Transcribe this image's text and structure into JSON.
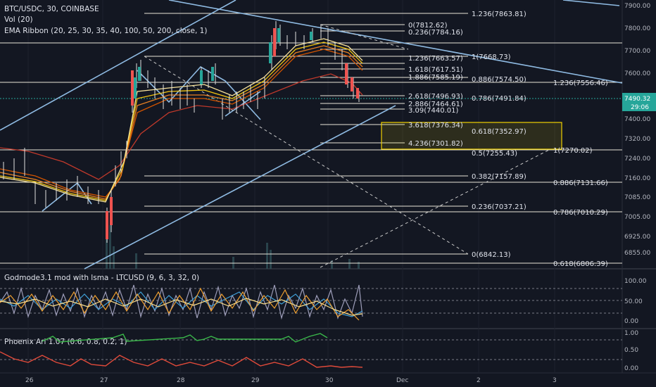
{
  "header": {
    "symbol_line": "BTC/USDC, 30, COINBASE",
    "vol_label": "Vol (20)",
    "ema_label": "EMA Ribbon (20, 25, 30, 35, 40, 100, 50, 200, close, 1)"
  },
  "price_axis": {
    "ticks": [
      "7900.00",
      "7800.00",
      "7700.00",
      "7600.00",
      "7490.32",
      "29:06",
      "7400.00",
      "7320.00",
      "7240.00",
      "7160.00",
      "7085.00",
      "7005.00",
      "6925.00",
      "6855.00"
    ],
    "current_price": "7490.32",
    "countdown": "29:06"
  },
  "time_axis": {
    "ticks": [
      "26",
      "27",
      "28",
      "29",
      "30",
      "Dec",
      "2",
      "3"
    ]
  },
  "fib_labels": {
    "upper": [
      "1.236(7863.81)",
      "0(7812.62)",
      "0.236(7784.16)",
      "1(7668.73)",
      "1.618(7617.51)",
      "1.886(7585.19)",
      "1.236(7663.57)",
      "0.886(7574.50)",
      "1.236(7556.46)",
      "2.618(7496.93)",
      "0.786(7491.84)",
      "2.886(7464.61)",
      "3.09(7440.01)"
    ],
    "mid": [
      "3.618(7376.34)",
      "0.618(7352.97)",
      "4.236(7301.82)",
      "0.5(7255.43)",
      "1(7270.02)"
    ],
    "lower": [
      "0.382(7157.89)",
      "0.886(7131.66)",
      "0.236(7037.21)",
      "0.786(7010.29)",
      "0(6842.13)",
      "0.618(6806.39)"
    ]
  },
  "oscillator1": {
    "label": "Godmode3.1 mod with lsma - LTCUSD (9, 6, 3, 32, 0)",
    "ticks": [
      "100.00",
      "50.00",
      "0.00"
    ]
  },
  "oscillator2": {
    "label": "Phoenix Ari 1.07 (0.6, 0.8, 0.2, 1)",
    "ticks": [
      "1.00",
      "0.50",
      "0.00"
    ]
  },
  "colors": {
    "background": "#131722",
    "fib_line": "#e8e6d8",
    "trendline": "#8fbbe3",
    "price_line": "#26a69a",
    "highlight_box": "#f0d000",
    "current_price_tag": "#26a69a"
  }
}
